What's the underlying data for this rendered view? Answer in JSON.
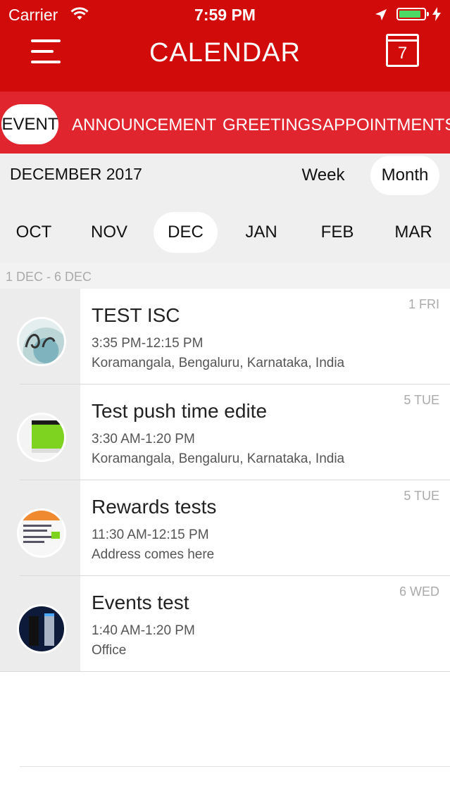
{
  "status_bar": {
    "carrier": "Carrier",
    "time": "7:59 PM",
    "battery_level": 0.9,
    "battery_color": "#4cd964"
  },
  "nav": {
    "title": "CALENDAR",
    "calendar_day": "7",
    "menu_icon": "hamburger-icon",
    "calendar_icon": "calendar-icon"
  },
  "tabs": [
    {
      "label": "EVENT",
      "active": true
    },
    {
      "label": "ANNOUNCEMENT",
      "active": false
    },
    {
      "label": "GREETINGS",
      "active": false
    },
    {
      "label": "APPOINTMENTS",
      "active": false
    }
  ],
  "period": {
    "label": "DECEMBER 2017",
    "week_label": "Week",
    "month_label": "Month",
    "selected_view": "Month"
  },
  "months": [
    "OCT",
    "NOV",
    "DEC",
    "JAN",
    "FEB",
    "MAR"
  ],
  "selected_month": "DEC",
  "range_header": "1 DEC - 6 DEC",
  "events": [
    {
      "title": "TEST ISC",
      "time": "3:35 PM-12:15 PM",
      "place": "Koramangala, Bengaluru, Karnataka, India",
      "date": "1 FRI"
    },
    {
      "title": "Test push time edite",
      "time": "3:30 AM-1:20 PM",
      "place": "Koramangala, Bengaluru, Karnataka, India",
      "date": "5 TUE"
    },
    {
      "title": "Rewards tests",
      "time": "11:30 AM-12:15 PM",
      "place": "Address comes here",
      "date": "5 TUE"
    },
    {
      "title": "Events test",
      "time": "1:40 AM-1:20 PM",
      "place": "Office",
      "date": "6 WED"
    }
  ],
  "colors": {
    "brand_red": "#d10a0a",
    "tab_red": "#e0252e",
    "panel_gray": "#efefef"
  }
}
